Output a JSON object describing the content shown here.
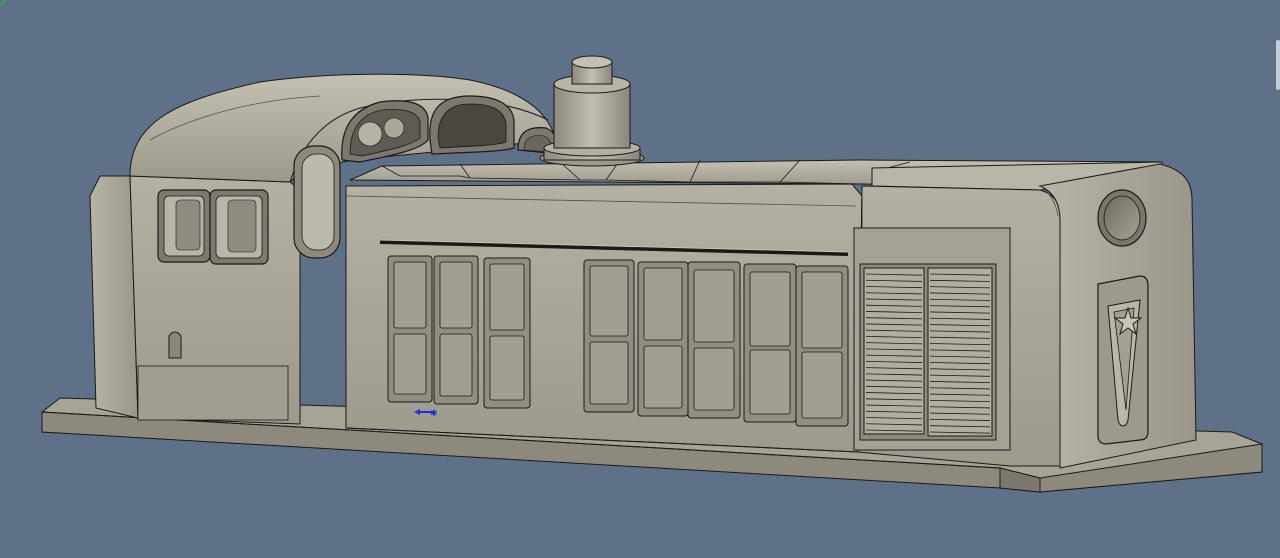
{
  "viewport": {
    "background": "#5f7089",
    "model_name": "locomotive-body-model"
  },
  "colors": {
    "body_fill": "#a9a597",
    "body_light": "#bab6a8",
    "body_dark": "#77736a",
    "body_mid": "#8f8b80",
    "edge": "#1a1a1a",
    "cursor_color": "#1f2fd6"
  },
  "model": {
    "cab_windows": 2,
    "roof_portholes": 3,
    "side_doors_left_group": 3,
    "side_doors_right_group": 5,
    "louver_panels": 2,
    "emblem": "star-emblem"
  }
}
